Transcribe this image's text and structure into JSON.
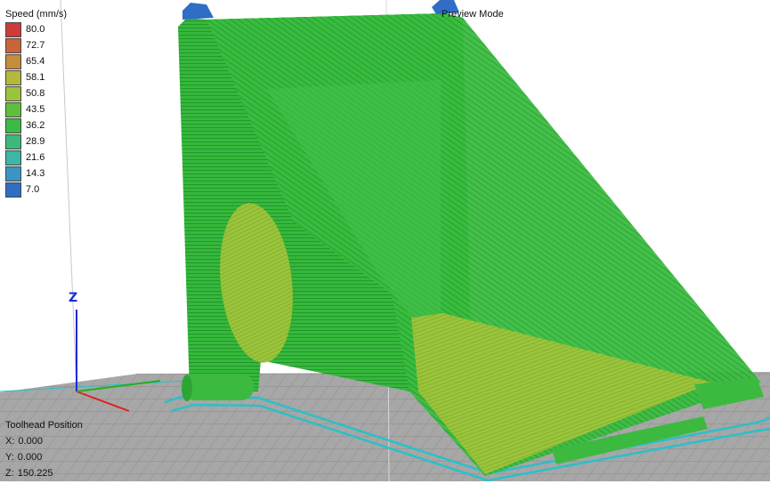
{
  "legend": {
    "title": "Speed (mm/s)",
    "items": [
      {
        "value": "80.0",
        "color": "#cf3b3b"
      },
      {
        "value": "72.7",
        "color": "#c9643a"
      },
      {
        "value": "65.4",
        "color": "#c58c3a"
      },
      {
        "value": "58.1",
        "color": "#b4b93c"
      },
      {
        "value": "50.8",
        "color": "#9bc43c"
      },
      {
        "value": "43.5",
        "color": "#5ebf3e"
      },
      {
        "value": "36.2",
        "color": "#3cba46"
      },
      {
        "value": "28.9",
        "color": "#3cb87a"
      },
      {
        "value": "21.6",
        "color": "#3cb6a6"
      },
      {
        "value": "14.3",
        "color": "#3a95c4"
      },
      {
        "value": "7.0",
        "color": "#2f6ec4"
      }
    ]
  },
  "mode_label": "Preview Mode",
  "toolhead": {
    "title": "Toolhead Position",
    "x_label": "X:",
    "x_value": "0.000",
    "y_label": "Y:",
    "y_value": "0.000",
    "z_label": "Z:",
    "z_value": "150.225"
  },
  "axis": {
    "z_label": "Z"
  },
  "colors": {
    "bed": "#a9a9a9",
    "bed_grid": "#8a8a8a",
    "model_green": "#36b83c",
    "model_yellow_green": "#9cc53a",
    "outline_cyan": "#2bc0c8",
    "axis_x": "#e02020",
    "axis_y": "#20b020",
    "axis_z": "#1a2bd8"
  }
}
